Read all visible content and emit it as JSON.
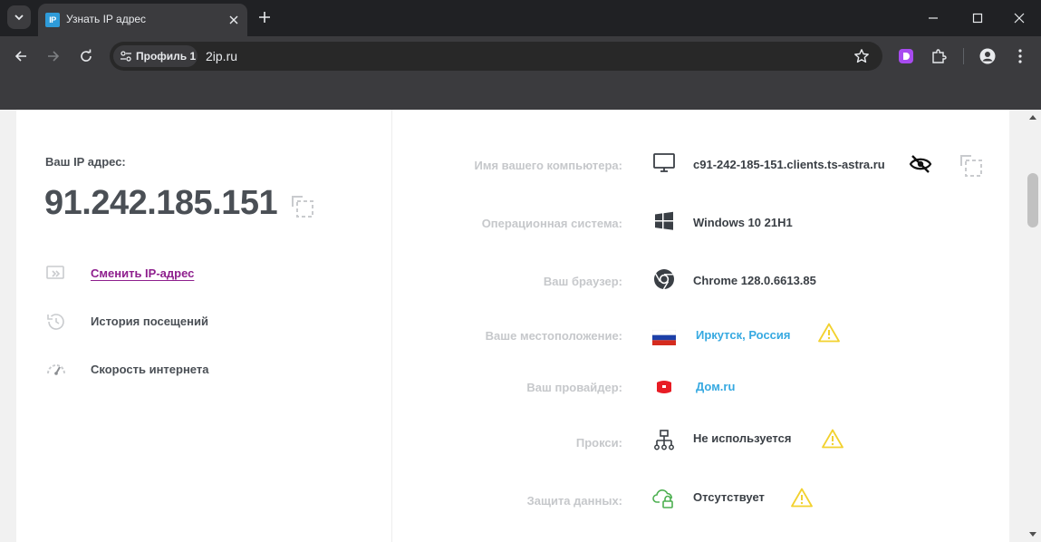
{
  "browser": {
    "tab_title": "Узнать IP адрес",
    "tab_favicon_text": "IP",
    "profile_label": "Профиль 1",
    "url": "2ip.ru",
    "theme_dark": "#202124",
    "toolbar_color": "#3b3b3e"
  },
  "left": {
    "ip_label": "Ваш IP адрес:",
    "ip_value": "91.242.185.151",
    "menu": [
      {
        "label": "Сменить IP-адрес",
        "icon": "change-ip-icon",
        "link": true
      },
      {
        "label": "История посещений",
        "icon": "history-icon",
        "link": false
      },
      {
        "label": "Скорость интернета",
        "icon": "speedometer-icon",
        "link": false
      }
    ]
  },
  "right": {
    "rows": [
      {
        "label": "Имя вашего компьютера:",
        "value": "c91-242-185-151.clients.ts-astra.ru",
        "icon": "monitor-icon"
      },
      {
        "label": "Операционная система:",
        "value": "Windows 10 21H1",
        "icon": "windows-icon"
      },
      {
        "label": "Ваш браузер:",
        "value": "Chrome 128.0.6613.85",
        "icon": "chrome-icon"
      },
      {
        "label": "Ваше местоположение:",
        "value": "Иркутск, Россия",
        "icon": "russia-flag-icon"
      },
      {
        "label": "Ваш провайдер:",
        "value": "Дом.ru",
        "icon": "provider-logo-icon"
      },
      {
        "label": "Прокси:",
        "value": "Не используется",
        "icon": "proxy-network-icon"
      },
      {
        "label": "Защита данных:",
        "value": "Отсутствует",
        "icon": "cloud-lock-icon"
      }
    ]
  },
  "colors": {
    "link_purple": "#8e1f8d",
    "link_blue": "#36a9e1",
    "warning_yellow": "#f2d12e",
    "label_gray": "#c6c8cb",
    "text_dark": "#4a4f55"
  }
}
